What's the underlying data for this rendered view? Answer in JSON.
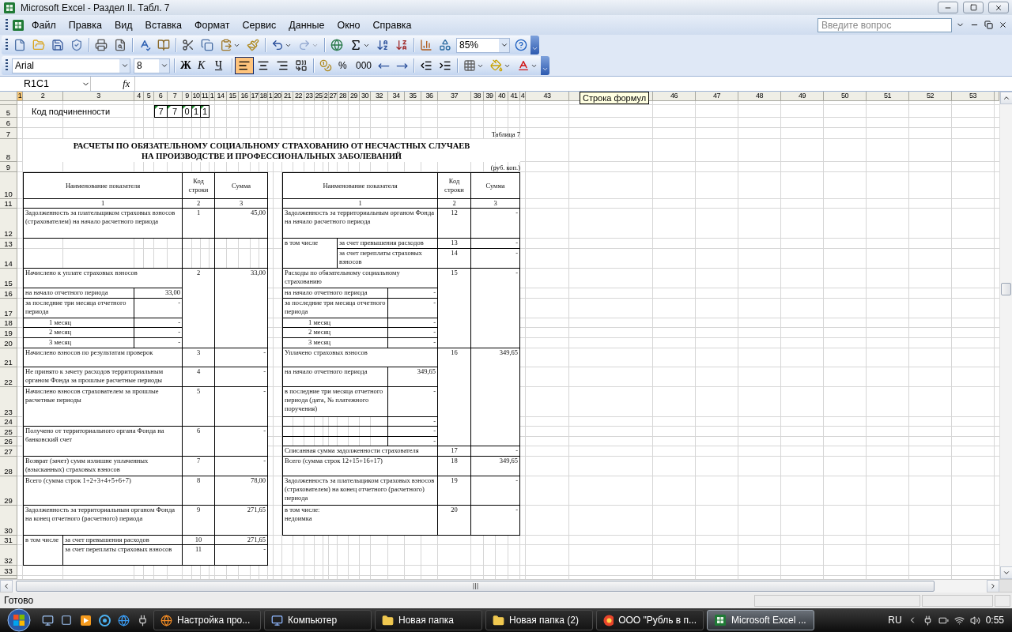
{
  "window": {
    "title": "Microsoft Excel - Раздел II. Табл. 7"
  },
  "menu": [
    "Файл",
    "Правка",
    "Вид",
    "Вставка",
    "Формат",
    "Сервис",
    "Данные",
    "Окно",
    "Справка"
  ],
  "help_search": {
    "placeholder": "Введите вопрос"
  },
  "standard_toolbar": {
    "zoom": "85%",
    "redo": {
      "disabled": true
    }
  },
  "formatting_toolbar": {
    "font": "Arial",
    "size": "8",
    "style_buttons": [
      "Ж",
      "К",
      "Ч"
    ],
    "alignment": [
      {
        "kind": "left",
        "selected": true
      },
      {
        "kind": "center",
        "selected": false
      },
      {
        "kind": "right",
        "selected": false
      }
    ],
    "number_buttons": [
      "%",
      "000"
    ]
  },
  "formula_bar": {
    "name_box": "R1C1",
    "function_label": "fx"
  },
  "tooltip": "Строка формул",
  "sheet": {
    "columns": [
      {
        "label": "1",
        "selected": true
      },
      {
        "label": "2",
        "selected": false
      },
      {
        "label": "3",
        "selected": false
      },
      {
        "label": "4",
        "selected": false
      },
      {
        "label": "5",
        "selected": false
      },
      {
        "label": "6",
        "selected": false
      },
      {
        "label": "7",
        "selected": false
      },
      {
        "label": "9",
        "selected": false
      },
      {
        "label": "10",
        "selected": false
      },
      {
        "label": "11",
        "selected": false
      },
      {
        "label": "1",
        "selected": false
      },
      {
        "label": "14",
        "selected": false
      },
      {
        "label": "15",
        "selected": false
      },
      {
        "label": "16",
        "selected": false
      },
      {
        "label": "17",
        "selected": false
      },
      {
        "label": "18",
        "selected": false
      },
      {
        "label": "1",
        "selected": false
      },
      {
        "label": "20",
        "selected": false
      },
      {
        "label": "21",
        "selected": false
      },
      {
        "label": "22",
        "selected": false
      },
      {
        "label": "23",
        "selected": false
      },
      {
        "label": "25",
        "selected": false
      },
      {
        "label": "2",
        "selected": false
      },
      {
        "label": "27",
        "selected": false
      },
      {
        "label": "28",
        "selected": false
      },
      {
        "label": "29",
        "selected": false
      },
      {
        "label": "30",
        "selected": false
      },
      {
        "label": "32",
        "selected": false
      },
      {
        "label": "34",
        "selected": false
      },
      {
        "label": "35",
        "selected": false
      },
      {
        "label": "36",
        "selected": false
      },
      {
        "label": "37",
        "selected": false
      },
      {
        "label": "38",
        "selected": false
      },
      {
        "label": "39",
        "selected": false
      },
      {
        "label": "40",
        "selected": false
      },
      {
        "label": "41",
        "selected": false
      },
      {
        "label": "4",
        "selected": false
      },
      {
        "label": "43",
        "selected": false
      },
      {
        "label": "46",
        "selected": false
      },
      {
        "label": "47",
        "selected": false
      },
      {
        "label": "48",
        "selected": false
      },
      {
        "label": "49",
        "selected": false
      },
      {
        "label": "50",
        "selected": false
      },
      {
        "label": "51",
        "selected": false
      },
      {
        "label": "52",
        "selected": false
      },
      {
        "label": "53",
        "selected": false
      }
    ],
    "rows": [
      "5",
      "6",
      "7",
      "8",
      "9",
      "10",
      "11",
      "12",
      "13",
      "14",
      "15",
      "16",
      "17",
      "18",
      "19",
      "20",
      "21",
      "22",
      "23",
      "24",
      "25",
      "26",
      "27",
      "28",
      "29",
      "30",
      "31",
      "32",
      "33"
    ],
    "subordination": {
      "label": "Код подчиненности",
      "digits": [
        "7",
        "7",
        "0",
        "1",
        "1"
      ]
    },
    "table_caption": "Таблица 7",
    "title_lines": [
      "РАСЧЕТЫ ПО ОБЯЗАТЕЛЬНОМУ СОЦИАЛЬНОМУ СТРАХОВАНИЮ ОТ НЕСЧАСТНЫХ СЛУЧАЕВ",
      "НА ПРОИЗВОДСТВЕ И ПРОФЕССИОНАЛЬНЫХ ЗАБОЛЕВАНИЙ"
    ],
    "units": "(руб. коп.)",
    "left_table": {
      "headers": [
        "Наименование показателя",
        "Код строки",
        "Сумма"
      ],
      "column_numbers": [
        "1",
        "2",
        "3"
      ],
      "rows": [
        {
          "kind": "item",
          "name": "Задолженность за плательщиком страховых взносов (страхователем) на начало расчетного периода",
          "code": "1",
          "sum": "45,00"
        },
        {
          "kind": "blank"
        },
        {
          "kind": "item",
          "name": "Начислено к уплате страховых взносов",
          "code": "2",
          "sum": "33,00",
          "subs": [
            {
              "kind": "line",
              "name": "на начало отчетного периода",
              "value": "33,00"
            },
            {
              "kind": "line",
              "name": "за последние три месяца отчетного периода",
              "value": "-"
            },
            {
              "kind": "month",
              "name": "1 месяц",
              "value": "-"
            },
            {
              "kind": "month",
              "name": "2 месяц",
              "value": "-"
            },
            {
              "kind": "month",
              "name": "3 месяц",
              "value": "-"
            }
          ]
        },
        {
          "kind": "item",
          "name": "Начислено взносов по результатам проверок",
          "code": "3",
          "sum": "-"
        },
        {
          "kind": "item",
          "name": "Не принято к зачету расходов территориальным органом Фонда за прошлые расчетные периоды",
          "code": "4",
          "sum": "-"
        },
        {
          "kind": "item",
          "name": "Начислено взносов  страхователем за прошлые расчетные периоды",
          "code": "5",
          "sum": "-"
        },
        {
          "kind": "item",
          "name": "Получено от территориального органа Фонда на банковский счет",
          "code": "6",
          "sum": "-"
        },
        {
          "kind": "item",
          "name": "Возврат (зачет) сумм излишне уплаченных (взысканных) страховых взносов",
          "code": "7",
          "sum": "-"
        },
        {
          "kind": "item",
          "name": "Всего  (сумма строк 1+2+3+4+5+6+7)",
          "code": "8",
          "sum": "78,00"
        },
        {
          "kind": "item",
          "name": "Задолженность за территориальным органом Фонда на конец отчетного (расчетного) периода",
          "code": "9",
          "sum": "271,65"
        },
        {
          "kind": "group",
          "label": "в том числе",
          "items": [
            {
              "name": "за счет превышения расходов",
              "code": "10",
              "sum": "271,65"
            },
            {
              "name": "за счет переплаты страховых взносов",
              "code": "11",
              "sum": "-"
            }
          ]
        }
      ]
    },
    "right_table": {
      "headers": [
        "Наименование показателя",
        "Код строки",
        "Сумма"
      ],
      "column_numbers": [
        "1",
        "2",
        "3"
      ],
      "rows": [
        {
          "kind": "item",
          "name": "Задолженность за территориальным органом Фонда на начало расчетного периода",
          "code": "12",
          "sum": "-"
        },
        {
          "kind": "group",
          "label": "в том числе",
          "items": [
            {
              "name": "за счет превышения расходов",
              "code": "13",
              "sum": "-"
            },
            {
              "name": "за счет переплаты страховых взносов",
              "code": "14",
              "sum": "-"
            }
          ]
        },
        {
          "kind": "item",
          "name": "Расходы по обязательному социальному страхованию",
          "code": "15",
          "sum": "-",
          "subs": [
            {
              "kind": "line",
              "name": "на начало отчетного периода",
              "value": "-"
            },
            {
              "kind": "line",
              "name": "за последние три месяца отчетного периода",
              "value": "-"
            },
            {
              "kind": "month",
              "name": "1 месяц",
              "value": "-"
            },
            {
              "kind": "month",
              "name": "2 месяц",
              "value": "-"
            },
            {
              "kind": "month",
              "name": "3 месяц",
              "value": "-"
            }
          ]
        },
        {
          "kind": "item",
          "name": "Уплачено страховых взносов",
          "code": "16",
          "sum": "349,65",
          "subs": [
            {
              "kind": "line",
              "name": "на начало отчетного периода",
              "value": "349,65"
            },
            {
              "kind": "line",
              "name": "в последние три месяца отчетного периода (дата, № платежного поручения)",
              "value": "-"
            },
            {
              "kind": "empty",
              "value": "-"
            },
            {
              "kind": "empty",
              "value": "-"
            },
            {
              "kind": "empty",
              "value": "-"
            }
          ]
        },
        {
          "kind": "item",
          "name": "Списанная сумма задолженности страхователя",
          "code": "17",
          "sum": "-"
        },
        {
          "kind": "item",
          "name": "Всего (сумма строк 12+15+16+17)",
          "code": "18",
          "sum": "349,65"
        },
        {
          "kind": "item",
          "name": "Задолженность за плательщиком страховых взносов (страхователем) на конец отчетного (расчетного) периода",
          "code": "19",
          "sum": "-"
        },
        {
          "kind": "item",
          "name": "в том числе:\nнедоимка",
          "code": "20",
          "sum": "-"
        }
      ]
    }
  },
  "status_bar": {
    "text": "Готово"
  },
  "taskbar": {
    "buttons": [
      {
        "kind": "browser",
        "label": "Настройка про...",
        "selected": false
      },
      {
        "kind": "computer",
        "label": "Компьютер",
        "selected": false
      },
      {
        "kind": "folder",
        "label": "Новая папка",
        "selected": false
      },
      {
        "kind": "folder",
        "label": "Новая папка (2)",
        "selected": false
      },
      {
        "kind": "app",
        "label": "ООО \"Рубль в п...",
        "selected": false
      },
      {
        "kind": "sheet",
        "label": "Microsoft Excel ...",
        "selected": true
      }
    ],
    "language": "RU",
    "clock": "0:55"
  }
}
